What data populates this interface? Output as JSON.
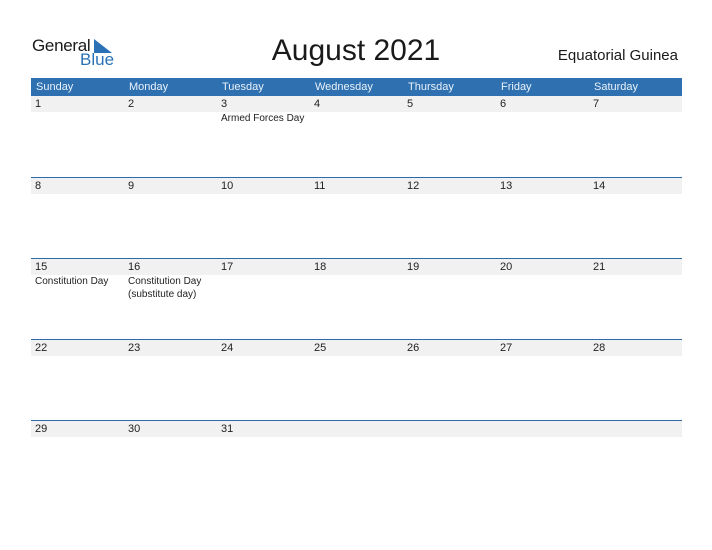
{
  "logo": {
    "line1": "General",
    "line2": "Blue"
  },
  "title": "August 2021",
  "country": "Equatorial Guinea",
  "colors": {
    "accent": "#2e70b0",
    "strip": "#f1f1f1"
  },
  "weekdays": [
    "Sunday",
    "Monday",
    "Tuesday",
    "Wednesday",
    "Thursday",
    "Friday",
    "Saturday"
  ],
  "weeks": [
    {
      "days": [
        {
          "n": "1",
          "e": ""
        },
        {
          "n": "2",
          "e": ""
        },
        {
          "n": "3",
          "e": "Armed Forces Day"
        },
        {
          "n": "4",
          "e": ""
        },
        {
          "n": "5",
          "e": ""
        },
        {
          "n": "6",
          "e": ""
        },
        {
          "n": "7",
          "e": ""
        }
      ]
    },
    {
      "days": [
        {
          "n": "8",
          "e": ""
        },
        {
          "n": "9",
          "e": ""
        },
        {
          "n": "10",
          "e": ""
        },
        {
          "n": "11",
          "e": ""
        },
        {
          "n": "12",
          "e": ""
        },
        {
          "n": "13",
          "e": ""
        },
        {
          "n": "14",
          "e": ""
        }
      ]
    },
    {
      "days": [
        {
          "n": "15",
          "e": "Constitution Day"
        },
        {
          "n": "16",
          "e": "Constitution Day (substitute day)"
        },
        {
          "n": "17",
          "e": ""
        },
        {
          "n": "18",
          "e": ""
        },
        {
          "n": "19",
          "e": ""
        },
        {
          "n": "20",
          "e": ""
        },
        {
          "n": "21",
          "e": ""
        }
      ]
    },
    {
      "days": [
        {
          "n": "22",
          "e": ""
        },
        {
          "n": "23",
          "e": ""
        },
        {
          "n": "24",
          "e": ""
        },
        {
          "n": "25",
          "e": ""
        },
        {
          "n": "26",
          "e": ""
        },
        {
          "n": "27",
          "e": ""
        },
        {
          "n": "28",
          "e": ""
        }
      ]
    },
    {
      "days": [
        {
          "n": "29",
          "e": ""
        },
        {
          "n": "30",
          "e": ""
        },
        {
          "n": "31",
          "e": ""
        },
        {
          "n": "",
          "e": ""
        },
        {
          "n": "",
          "e": ""
        },
        {
          "n": "",
          "e": ""
        },
        {
          "n": "",
          "e": ""
        }
      ]
    }
  ]
}
